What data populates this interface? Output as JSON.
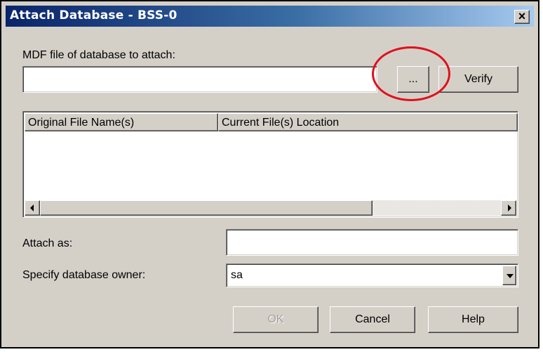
{
  "window": {
    "title": "Attach Database - BSS-0",
    "close_glyph": "×"
  },
  "mdf": {
    "label": "MDF file of database to attach:",
    "value": "",
    "browse_label": "...",
    "verify_label": "Verify"
  },
  "files_list": {
    "columns": [
      "Original File Name(s)",
      "Current File(s) Location"
    ],
    "rows": []
  },
  "attach_as": {
    "label": "Attach as:",
    "value": ""
  },
  "owner": {
    "label": "Specify database owner:",
    "selected": "sa"
  },
  "buttons": {
    "ok": "OK",
    "cancel": "Cancel",
    "help": "Help"
  },
  "icons": {
    "close": "close-icon",
    "scroll_left": "arrow-left-icon",
    "scroll_right": "arrow-right-icon",
    "dropdown": "chevron-down-icon"
  },
  "colors": {
    "dialog_bg": "#d4d0c8",
    "title_start": "#0a246a",
    "title_end": "#a6caf0",
    "annotation": "#e0101c"
  }
}
